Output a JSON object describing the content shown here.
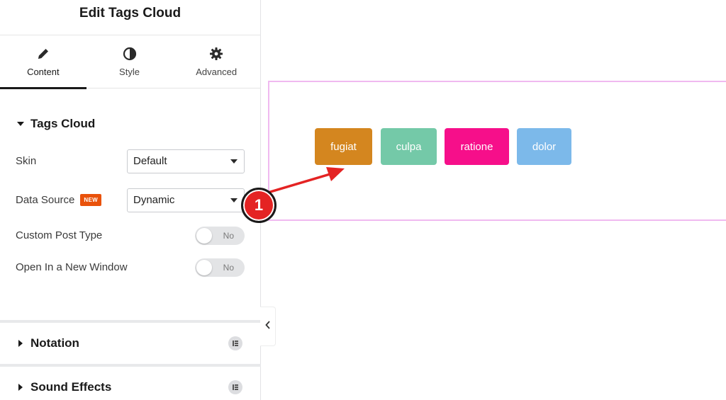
{
  "panel": {
    "title": "Edit Tags Cloud",
    "tabs": [
      {
        "label": "Content",
        "icon": "pencil-icon",
        "active": true
      },
      {
        "label": "Style",
        "icon": "half-circle-icon",
        "active": false
      },
      {
        "label": "Advanced",
        "icon": "gear-icon",
        "active": false
      }
    ],
    "open_section": {
      "title": "Tags Cloud",
      "skin": {
        "label": "Skin",
        "value": "Default"
      },
      "data_source": {
        "label": "Data Source",
        "badge": "NEW",
        "value": "Dynamic"
      },
      "custom_post_type": {
        "label": "Custom Post Type",
        "value": "No"
      },
      "open_new_window": {
        "label": "Open In a New Window",
        "value": "No"
      }
    },
    "closed_sections": [
      {
        "title": "Notation",
        "icon": "elementskit-icon"
      },
      {
        "title": "Sound Effects",
        "icon": "elementskit-icon"
      }
    ],
    "collapse_icon": "chevron-left-icon"
  },
  "preview": {
    "tags": [
      {
        "label": "fugiat",
        "color": "#d4861f"
      },
      {
        "label": "culpa",
        "color": "#74c9a8"
      },
      {
        "label": "ratione",
        "color": "#f60f8a"
      },
      {
        "label": "dolor",
        "color": "#7cb9ea"
      }
    ],
    "border_color": "#f0b9f0"
  },
  "annotation": {
    "step_number": "1",
    "color": "#e42323"
  }
}
